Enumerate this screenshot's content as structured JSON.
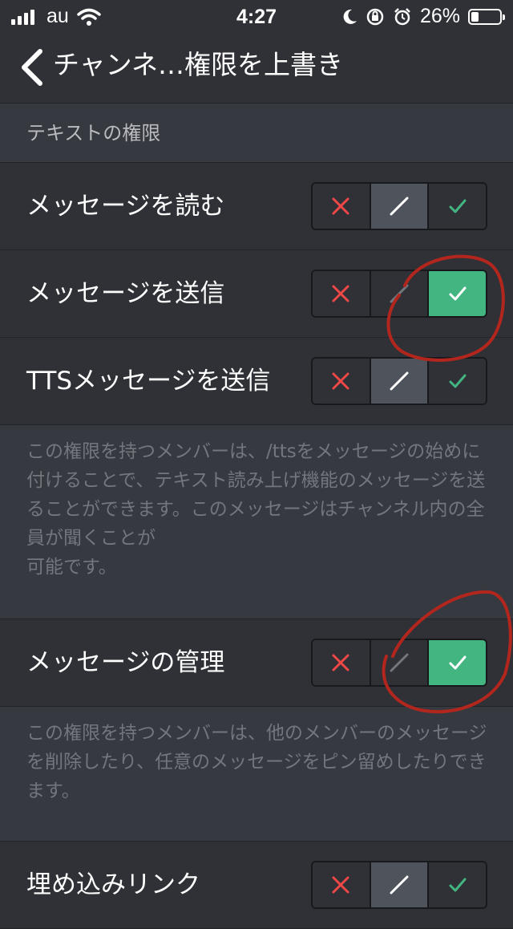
{
  "status_bar": {
    "carrier": "au",
    "time": "4:27",
    "battery": "26%",
    "battery_level": 0.26,
    "icons": [
      "signal-icon",
      "wifi-icon",
      "moon-icon",
      "rotation-lock-icon",
      "alarm-icon",
      "battery-icon"
    ]
  },
  "navbar": {
    "title": "チャンネ…権限を上書き",
    "back_icon": "chevron-left-icon"
  },
  "section": {
    "title": "テキストの権限"
  },
  "permissions": [
    {
      "label": "メッセージを読む",
      "state": "neutral"
    },
    {
      "label": "メッセージを送信",
      "state": "allow"
    },
    {
      "label": "TTSメッセージを送信",
      "state": "neutral"
    },
    {
      "label": "メッセージの管理",
      "state": "allow"
    },
    {
      "label": "埋め込みリンク",
      "state": "neutral"
    }
  ],
  "descriptions": {
    "tts": "この権限を持つメンバーは、/ttsをメッセージの始めに付けることで、テキスト読み上げ機能のメッセージを送ることができます。このメッセージはチャンネル内の全員が聞くことが\n可能です。",
    "manage": "この権限を持つメンバーは、他のメンバーのメッセージを削除したり、任意のメッセージをピン留めしたりできます。"
  },
  "colors": {
    "background": "#2f3136",
    "deny": "#f04747",
    "allow": "#43b581",
    "neutral_active": "#4f545c",
    "annotation": "#b3261e"
  }
}
